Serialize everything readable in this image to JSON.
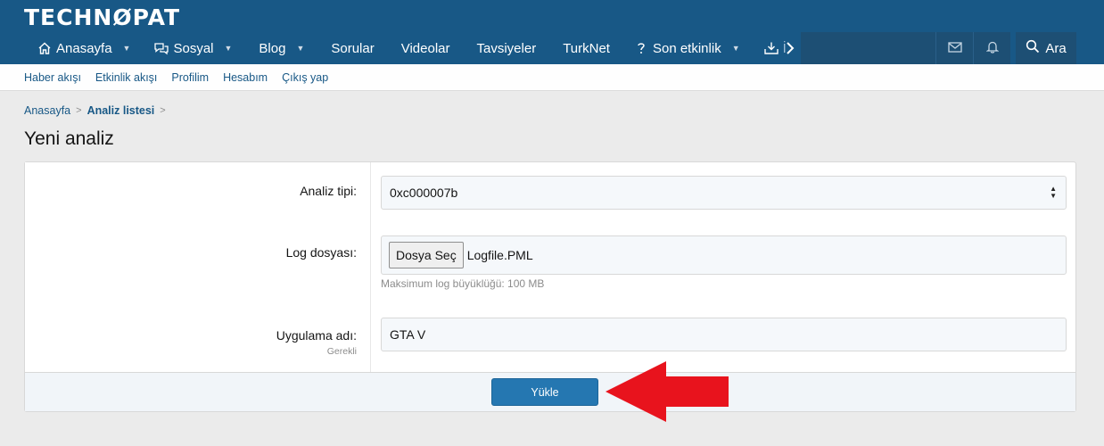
{
  "header": {
    "logo": "TECHNØPAT",
    "nav": [
      {
        "label": "Anasayfa",
        "icon": "home-icon",
        "caret": true
      },
      {
        "label": "Sosyal",
        "icon": "chat-icon",
        "caret": true
      },
      {
        "label": "Blog",
        "icon": "",
        "caret": true
      },
      {
        "label": "Sorular",
        "icon": "",
        "caret": false
      },
      {
        "label": "Videolar",
        "icon": "",
        "caret": false
      },
      {
        "label": "Tavsiyeler",
        "icon": "",
        "caret": false
      },
      {
        "label": "TurkNet",
        "icon": "",
        "caret": false
      },
      {
        "label": "Son etkinlik",
        "icon": "question-icon",
        "caret": true
      },
      {
        "label": "İ",
        "icon": "download-icon",
        "caret": false
      }
    ],
    "search_label": "Ara"
  },
  "subnav": [
    "Haber akışı",
    "Etkinlik akışı",
    "Profilim",
    "Hesabım",
    "Çıkış yap"
  ],
  "breadcrumb": {
    "home": "Anasayfa",
    "current": "Analiz listesi"
  },
  "page_title": "Yeni analiz",
  "form": {
    "type_label": "Analiz tipi:",
    "type_value": "0xc000007b",
    "log_label": "Log dosyası:",
    "file_button": "Dosya Seç",
    "file_name": "Logfile.PML",
    "hint": "Maksimum log büyüklüğü: 100 MB",
    "app_label": "Uygulama adı:",
    "app_required": "Gerekli",
    "app_value": "GTA V",
    "submit": "Yükle"
  },
  "colors": {
    "header": "#185886",
    "button": "#2577b1",
    "arrow": "#e8131d"
  }
}
